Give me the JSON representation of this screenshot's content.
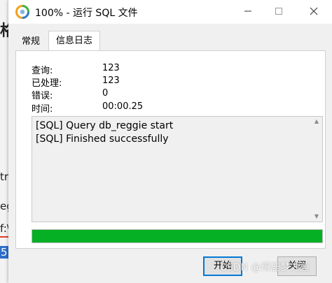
{
  "background": {
    "fragments": [
      "格",
      "tr",
      "eg",
      "f:\\",
      "5"
    ]
  },
  "window": {
    "title": "100% - 运行 SQL 文件",
    "icons": {
      "app": "navicat-logo-icon",
      "minimize": "minimize-icon",
      "maximize": "maximize-icon",
      "close": "close-icon"
    }
  },
  "tabs": [
    {
      "label": "常规",
      "active": false
    },
    {
      "label": "信息日志",
      "active": true
    }
  ],
  "stats": {
    "query_label": "查询:",
    "query_value": "123",
    "processed_label": "已处理:",
    "processed_value": "123",
    "errors_label": "错误:",
    "errors_value": "0",
    "time_label": "时间:",
    "time_value": "00:00.25"
  },
  "log": {
    "lines": [
      "[SQL] Query db_reggie start",
      "[SQL] Finished successfully"
    ]
  },
  "progress": {
    "percent": 100,
    "color": "#06b025"
  },
  "buttons": {
    "start": "开始",
    "close": "关闭"
  },
  "watermark": "CSDN @得鹿梦为鱼"
}
